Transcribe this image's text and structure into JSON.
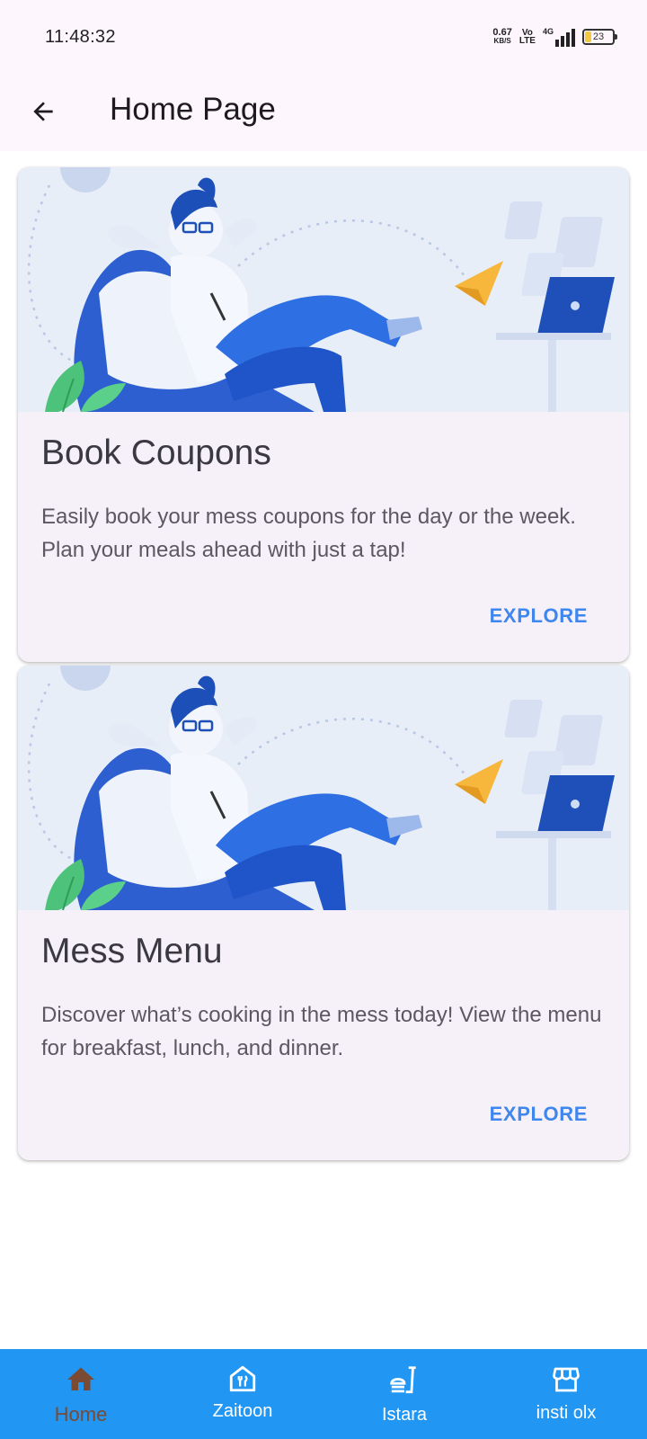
{
  "status_bar": {
    "time": "11:48:32",
    "net_speed_value": "0.67",
    "net_speed_unit": "KB/S",
    "volte_top": "Vo",
    "volte_bottom": "LTE",
    "network": "4G",
    "battery": "23"
  },
  "app_bar": {
    "title": "Home Page",
    "back_icon": "arrow-left-icon"
  },
  "cards": [
    {
      "title": "Book Coupons",
      "description": "Easily book your mess coupons for the day or the week. Plan your meals ahead with just a tap!",
      "action": "EXPLORE"
    },
    {
      "title": "Mess Menu",
      "description": "Discover what’s cooking in the mess today! View the menu for breakfast, lunch, and dinner.",
      "action": "EXPLORE"
    }
  ],
  "bottom_nav": {
    "items": [
      {
        "label": "Home",
        "icon": "home-icon",
        "active": true
      },
      {
        "label": "Zaitoon",
        "icon": "restaurant-icon",
        "active": false
      },
      {
        "label": "Istara",
        "icon": "fastfood-icon",
        "active": false
      },
      {
        "label": "insti olx",
        "icon": "store-icon",
        "active": false
      }
    ]
  },
  "colors": {
    "app_bar_bg": "#fdf6fc",
    "card_bg": "#f6f1f8",
    "accent": "#3f86ee",
    "nav_bg": "#2196f3",
    "nav_active": "#7a4a32"
  }
}
